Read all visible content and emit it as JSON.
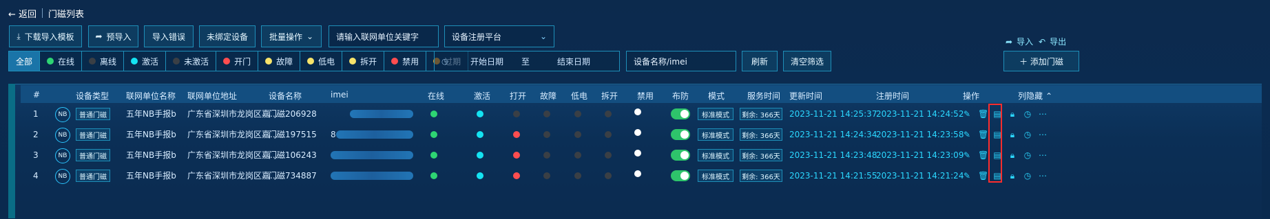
{
  "header": {
    "back": "← 返回",
    "title": "门磁列表"
  },
  "toolbar": {
    "download_template": "下载导入模板",
    "pre_import": "预导入",
    "import_errors": "导入错误",
    "unbind_device": "未绑定设备",
    "batch_ops": "批量操作",
    "unit_keyword_placeholder": "请输入联网单位关键字",
    "platform_select": "设备注册平台",
    "import": "导入",
    "export": "导出"
  },
  "filters": {
    "items": [
      {
        "label": "全部",
        "active": true
      },
      {
        "label": "在线",
        "dot": "#2ed573"
      },
      {
        "label": "离线",
        "dot": "#3a3f45"
      },
      {
        "label": "激活",
        "dot": "#14e3f2"
      },
      {
        "label": "未激活",
        "dot": "#3a3f45"
      },
      {
        "label": "开门",
        "dot": "#ff4d4f"
      },
      {
        "label": "故障",
        "dot": "#f7e36a"
      },
      {
        "label": "低电",
        "dot": "#f7e36a"
      },
      {
        "label": "拆开",
        "dot": "#f7e36a"
      },
      {
        "label": "禁用",
        "dot": "#ff4d4f"
      },
      {
        "label": "过期",
        "dot": "#ff9f1a"
      }
    ],
    "date_start": "开始日期",
    "date_to": "至",
    "date_end": "结束日期",
    "device_search_placeholder": "设备名称/imei",
    "refresh": "刷新",
    "clear": "清空筛选",
    "add": "＋ 添加门磁"
  },
  "table": {
    "headers": {
      "index": "#",
      "type": "设备类型",
      "unit": "联网单位名称",
      "address": "联网单位地址",
      "device": "设备名称",
      "imei": "imei",
      "online": "在线",
      "active": "激活",
      "open": "打开",
      "fault": "故障",
      "lowbat": "低电",
      "tamper": "拆开",
      "disabled": "禁用",
      "arm": "布防",
      "mode": "模式",
      "service": "服务时间",
      "updated": "更新时间",
      "registered": "注册时间",
      "actions": "操作",
      "hide_cols": "列隐藏"
    },
    "rows": [
      {
        "index": "1",
        "nb": "NB",
        "type": "普通门磁",
        "unit": "五年NB手报b",
        "address": "广东省深圳市龙岗区嘉...",
        "device": "门磁206928",
        "imei_prefix": "",
        "online": "#2ed573",
        "active": "#14e3f2",
        "open": "#3a3f45",
        "fault": "#3a3f45",
        "lowbat": "#3a3f45",
        "tamper": "#3a3f45",
        "disabled": "#ffffff",
        "mode": "标准模式",
        "service": "剩余: 366天",
        "updated": "2023-11-21 14:25:37",
        "registered": "2023-11-21 14:24:52"
      },
      {
        "index": "2",
        "nb": "NB",
        "type": "普通门磁",
        "unit": "五年NB手报b",
        "address": "广东省深圳市龙岗区嘉...",
        "device": "门磁197515",
        "imei_prefix": "8",
        "online": "#2ed573",
        "active": "#14e3f2",
        "open": "#ff4d4f",
        "fault": "#3a3f45",
        "lowbat": "#3a3f45",
        "tamper": "#3a3f45",
        "disabled": "#ffffff",
        "mode": "标准模式",
        "service": "剩余: 366天",
        "updated": "2023-11-21 14:24:34",
        "registered": "2023-11-21 14:23:58"
      },
      {
        "index": "3",
        "nb": "NB",
        "type": "普通门磁",
        "unit": "五年NB手报b",
        "address": "广东省深圳市龙岗区嘉...",
        "device": "门磁106243",
        "imei_prefix": "",
        "online": "#2ed573",
        "active": "#14e3f2",
        "open": "#ff4d4f",
        "fault": "#3a3f45",
        "lowbat": "#3a3f45",
        "tamper": "#3a3f45",
        "disabled": "#ffffff",
        "mode": "标准模式",
        "service": "剩余: 366天",
        "updated": "2023-11-21 14:23:48",
        "registered": "2023-11-21 14:23:09"
      },
      {
        "index": "4",
        "nb": "NB",
        "type": "普通门磁",
        "unit": "五年NB手报b",
        "address": "广东省深圳市龙岗区嘉...",
        "device": "门磁734887",
        "imei_prefix": "",
        "online": "#2ed573",
        "active": "#14e3f2",
        "open": "#ff4d4f",
        "fault": "#3a3f45",
        "lowbat": "#3a3f45",
        "tamper": "#3a3f45",
        "disabled": "#ffffff",
        "mode": "标准模式",
        "service": "剩余: 366天",
        "updated": "2023-11-21 14:21:55",
        "registered": "2023-11-21 14:21:24"
      }
    ]
  },
  "icons": {
    "back": "arrow-left-icon",
    "download": "download-icon",
    "share": "share-icon",
    "chevron": "chevron-down-icon",
    "calendar": "calendar-icon",
    "edit": "edit-icon",
    "delete": "trash-icon",
    "doc": "document-icon",
    "lock": "lock-icon",
    "clock": "clock-icon",
    "more": "more-icon",
    "up": "chevron-up-icon"
  }
}
